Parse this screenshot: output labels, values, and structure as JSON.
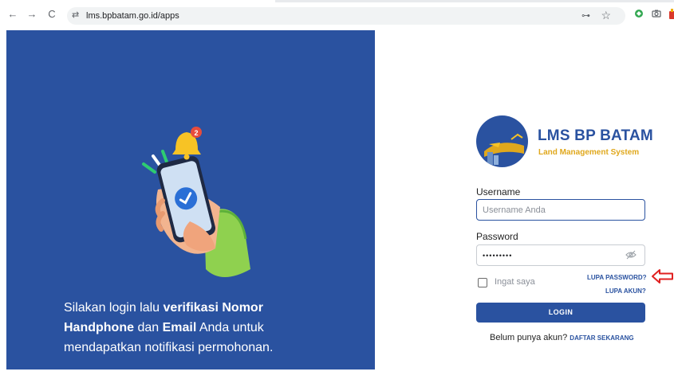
{
  "browser": {
    "url": "lms.bpbatam.go.id/apps",
    "back_glyph": "←",
    "forward_glyph": "→",
    "reload_glyph": "C",
    "tune_glyph": "⇄",
    "key_glyph": "⊶",
    "star_glyph": "☆"
  },
  "hero": {
    "caption": {
      "part1": "Silakan login lalu ",
      "bold1": "verifikasi Nomor Handphone",
      "part2": " dan ",
      "bold2": "Email",
      "part3": " Anda untuk mendapatkan notifikasi permohonan."
    },
    "illustration": "phone-verification-illustration",
    "notification_count": "2"
  },
  "brand": {
    "title": "LMS BP BATAM",
    "subtitle": "Land Management System"
  },
  "form": {
    "username_label": "Username",
    "username_placeholder": "Username Anda",
    "username_value": "",
    "password_label": "Password",
    "password_value": "•••••••••",
    "remember_label": "Ingat saya",
    "forgot_password": "LUPA PASSWORD?",
    "forgot_account": "LUPA AKUN?",
    "login_button": "LOGIN",
    "signup_prompt": "Belum punya akun?",
    "signup_link": "DAFTAR SEKARANG"
  },
  "colors": {
    "primary": "#2a52a0",
    "accent": "#e0a81d",
    "annotation": "#e02020"
  }
}
